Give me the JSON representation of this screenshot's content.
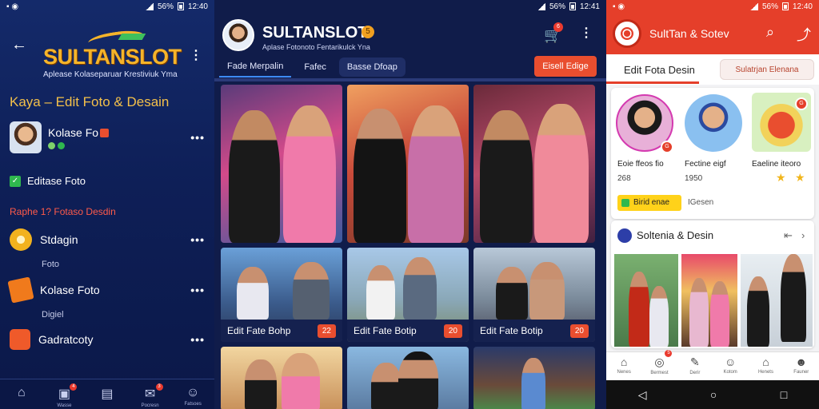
{
  "status_left": {
    "time": "12:40",
    "battery": "56%"
  },
  "status_mid": {
    "time": "12:41",
    "battery": "56%"
  },
  "status_right": {
    "time": "12:40",
    "battery": "56%"
  },
  "panel_left": {
    "logo": "SULTANSLOT",
    "tagline": "Aplease Kolaseparuar Krestiviuk Yma",
    "section_title": "Kaya – Edit Foto & Desain",
    "profile": {
      "title": "Kolase Fo"
    },
    "checkbox_label": "Editase Foto",
    "sub_heading": "Raphe 1? Fotaso Desdin",
    "menu": [
      {
        "label": "Stdagin",
        "sublabel": "Foto",
        "color": "#f2b21e"
      },
      {
        "label": "Kolase Foto",
        "sublabel": "Digiel",
        "color": "#f07a1c"
      },
      {
        "label": "Gadratcoty",
        "sublabel": "",
        "color": "#ef5a2a"
      }
    ],
    "nav": [
      {
        "icon": "⌂",
        "label": "",
        "badge": ""
      },
      {
        "icon": "▣",
        "label": "Wasse",
        "badge": "4"
      },
      {
        "icon": "▤",
        "label": "",
        "badge": ""
      },
      {
        "icon": "✉",
        "label": "Pocresn",
        "badge": "3"
      },
      {
        "icon": "☺",
        "label": "Fatsoes",
        "badge": ""
      }
    ]
  },
  "panel_mid": {
    "title": "SULTANSLOT",
    "verified_glyph": "5",
    "subtitle": "Aplase Fotonoto Fentarikulck Yna",
    "cart_badge": "6",
    "tabs": [
      "Fade Merpalin",
      "Fafec",
      "Basse Dfoap"
    ],
    "cta": "Eisell Edige",
    "captions": [
      {
        "text": "Edit Fate Bohp",
        "badge": "22"
      },
      {
        "text": "Edit Fate Botip",
        "badge": "20"
      },
      {
        "text": "Edit Fate Botip",
        "badge": "20"
      }
    ]
  },
  "panel_right": {
    "title": "SultTan & Sotev",
    "tab_active": "Edit Fota Desin",
    "tab_chip": "Sulatrjan Elenana",
    "profiles": [
      {
        "label": "Eoie ffeos fio",
        "count": "268"
      },
      {
        "label": "Fectine eigf",
        "count": "1950"
      },
      {
        "label": "Eaeline iteoro",
        "count": ""
      }
    ],
    "pill": "Birid enae",
    "tag": "IGesen",
    "section_title": "Soltenia & Desin",
    "nav": [
      {
        "icon": "⌂",
        "label": "Nenes",
        "badge": ""
      },
      {
        "icon": "◎",
        "label": "Bermest",
        "badge": "5"
      },
      {
        "icon": "✎",
        "label": "Derir",
        "badge": ""
      },
      {
        "icon": "☺",
        "label": "Kotom",
        "badge": ""
      },
      {
        "icon": "⌂",
        "label": "Henets",
        "badge": ""
      },
      {
        "icon": "☻",
        "label": "Fauner",
        "badge": ""
      }
    ]
  },
  "colors": {
    "accent_red": "#e53f2a",
    "accent_gold": "#f5b42a",
    "navy": "#101c4a"
  }
}
